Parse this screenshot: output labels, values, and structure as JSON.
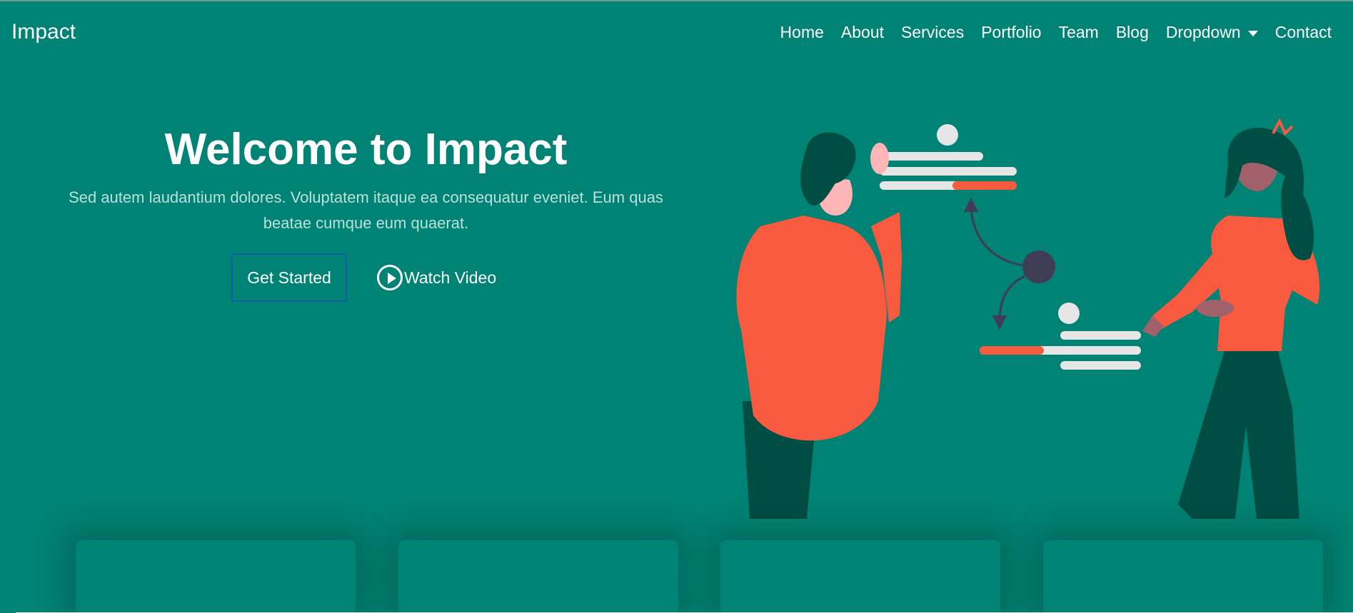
{
  "brand": "Impact",
  "nav": {
    "items": [
      "Home",
      "About",
      "Services",
      "Portfolio",
      "Team",
      "Blog",
      "Dropdown",
      "Contact"
    ]
  },
  "hero": {
    "title": "Welcome to Impact",
    "subtitle": "Sed autem laudantium dolores. Voluptatem itaque ea consequatur eveniet. Eum quas beatae cumque eum quaerat.",
    "primary_button": "Get Started",
    "video_button": "Watch Video"
  },
  "colors": {
    "background": "#008374",
    "accent": "#f85a40",
    "dark": "#004d43",
    "light": "#e6e6e6"
  },
  "icons": [
    "play-circle-icon",
    "chevron-down-icon"
  ]
}
